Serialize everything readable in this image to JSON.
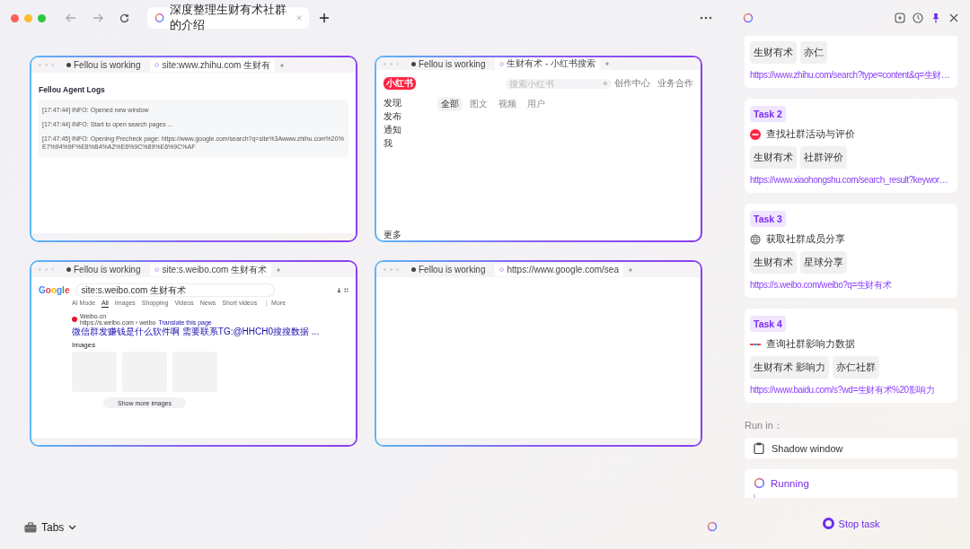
{
  "topbar": {
    "tab_title": "深度整理生财有术社群的介绍"
  },
  "thumbnails": [
    {
      "kind": "logs",
      "tabs": [
        "Fellou is working",
        "site:www.zhihu.com 生财有"
      ],
      "heading": "Fellou Agent Logs",
      "lines": [
        "[17:47:44] INFO: Opened new window",
        "[17:47:44] INFO: Start to open search pages ...",
        "[17:47:45] INFO: Opening Precheck page: https://www.google.com/search?q=site%3Awww.zhihu.com%20%E7%94%9F%E8%B4%A2%E6%9C%89%E6%9C%AF"
      ]
    },
    {
      "kind": "xiaohongshu",
      "tabs": [
        "Fellou is working",
        "生财有术 - 小红书搜索"
      ],
      "logo": "小红书",
      "search_placeholder": "搜索小红书",
      "links": [
        "创作中心",
        "业务合作"
      ],
      "nav": [
        "发现",
        "发布",
        "通知",
        "我"
      ],
      "more": "更多",
      "filters": [
        {
          "label": "全部",
          "selected": true
        },
        {
          "label": "图文",
          "selected": false
        },
        {
          "label": "视频",
          "selected": false
        },
        {
          "label": "用户",
          "selected": false
        }
      ]
    },
    {
      "kind": "google",
      "tabs": [
        "Fellou is working",
        "site:s.weibo.com 生财有术"
      ],
      "logo": "Google",
      "query": "site:s.weibo.com 生财有术",
      "filters": [
        {
          "label": "AI Mode",
          "selected": false
        },
        {
          "label": "All",
          "selected": true
        },
        {
          "label": "Images",
          "selected": false
        },
        {
          "label": "Shopping",
          "selected": false
        },
        {
          "label": "Videos",
          "selected": false
        },
        {
          "label": "News",
          "selected": false
        },
        {
          "label": "Short videos",
          "selected": false
        },
        {
          "label": "⋮ More",
          "selected": false
        }
      ],
      "result": {
        "site": "Weibo.cn",
        "url": "https://s.weibo.com › weibo",
        "translate": "Translate this page",
        "title": "微信群发赚钱是什么软件啊 需要联系TG:@HHCH0搜搜数据 ..."
      },
      "images_heading": "Images",
      "show_more": "Show more images"
    },
    {
      "kind": "blank",
      "tabs": [
        "Fellou is working",
        "https://www.google.com/sea"
      ]
    }
  ],
  "bottom_bar": {
    "tabs_label": "Tabs"
  },
  "panel": {
    "tasks": [
      {
        "tags": [
          "生财有术",
          "亦仁"
        ],
        "url": "https://www.zhihu.com/search?type=content&q=生财…"
      },
      {
        "label": "Task 2",
        "title": "查找社群活动与评价",
        "tags": [
          "生财有术",
          "社群评价"
        ],
        "url": "https://www.xiaohongshu.com/search_result?keywor…"
      },
      {
        "label": "Task 3",
        "title": "获取社群成员分享",
        "tags": [
          "生财有术",
          "星球分享"
        ],
        "url": "https://s.weibo.com/weibo?q=生财有术"
      },
      {
        "label": "Task 4",
        "title": "查询社群影响力数据",
        "tags": [
          "生财有术 影响力",
          "亦仁社群"
        ],
        "url": "https://www.baidu.com/s?wd=生财有术%20影响力"
      }
    ],
    "run_in_label": "Run in：",
    "run_in_value": "Shadow window",
    "status": "Running",
    "stop_button": "Stop task"
  }
}
